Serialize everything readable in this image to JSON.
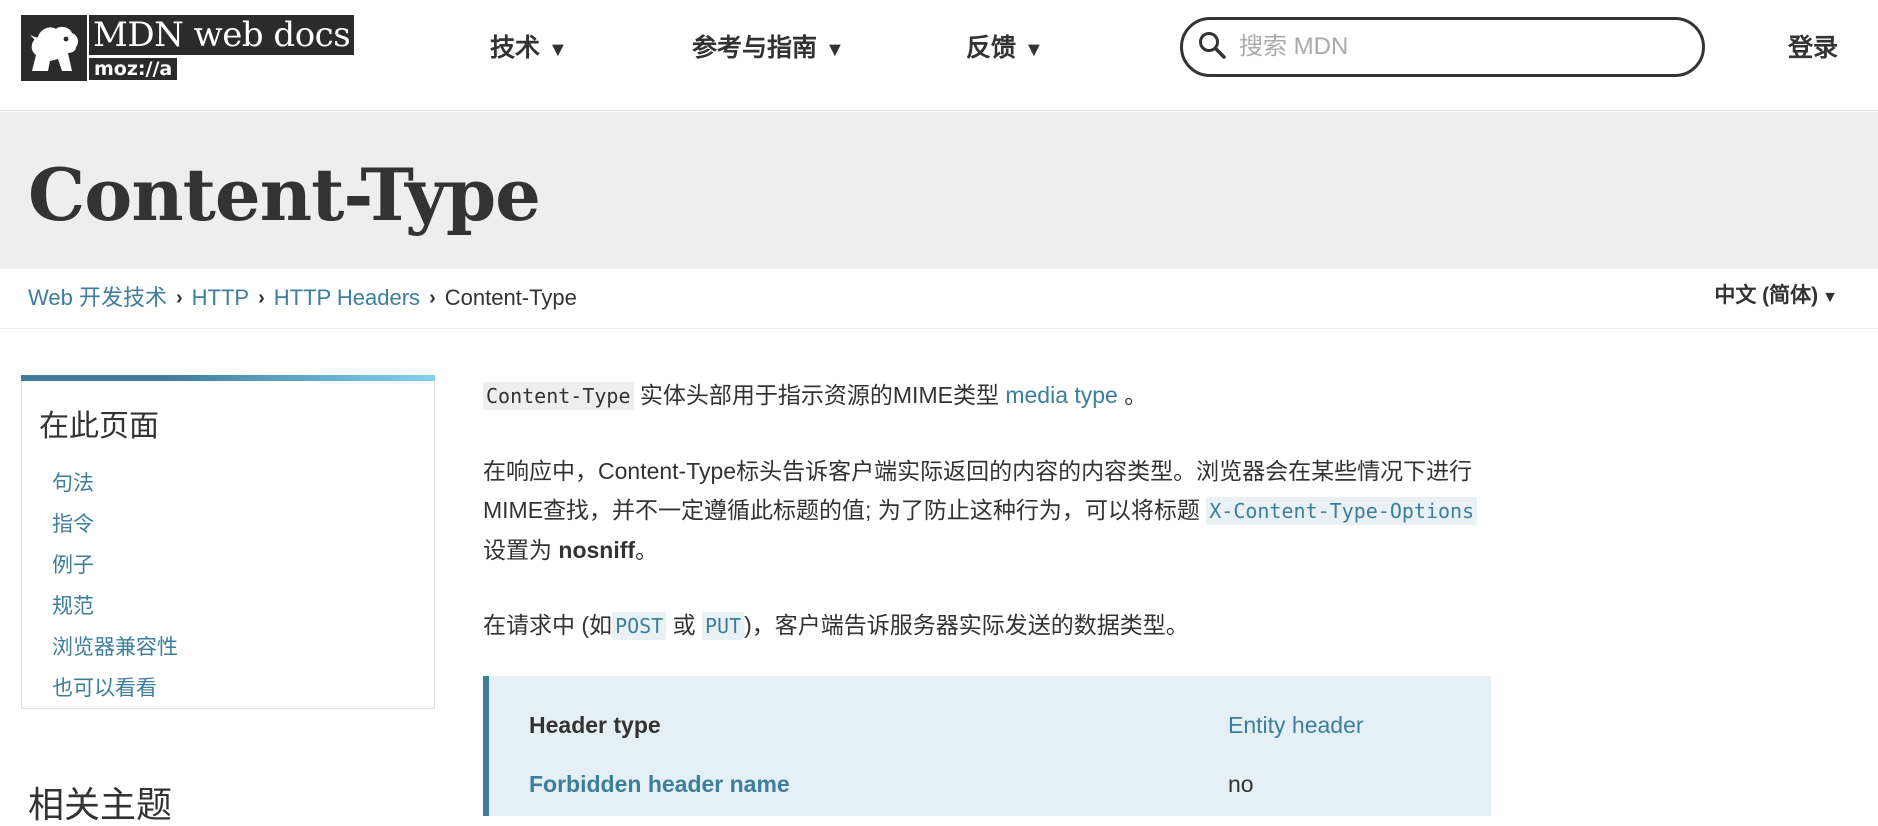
{
  "header": {
    "logo_title": "MDN web docs",
    "logo_sub": "moz://a",
    "nav": [
      {
        "label": "技术",
        "caret": "▼"
      },
      {
        "label": "参考与指南",
        "caret": "▼"
      },
      {
        "label": "反馈",
        "caret": "▼"
      }
    ],
    "search_placeholder": "搜索 MDN",
    "login_label": "登录"
  },
  "page": {
    "title": "Content-Type"
  },
  "breadcrumb": {
    "items": [
      "Web 开发技术",
      "HTTP",
      "HTTP Headers"
    ],
    "separator": "›",
    "current": "Content-Type"
  },
  "language": {
    "label": "中文 (简体)",
    "caret": "▼"
  },
  "toc": {
    "title": "在此页面",
    "items": [
      "句法",
      "指令",
      "例子",
      "规范",
      "浏览器兼容性",
      "也可以看看"
    ]
  },
  "related": {
    "title": "相关主题"
  },
  "content": {
    "p1": {
      "code": "Content-Type",
      "text": " 实体头部用于指示资源的MIME类型 ",
      "link": "media type",
      "end": " 。"
    },
    "p2": {
      "text1": "在响应中，Content-Type标头告诉客户端实际返回的内容的内容类型。浏览器会在某些情况下进行MIME查找，并不一定遵循此标题的值; 为了防止这种行为，可以将标题 ",
      "code_link": "X-Content-Type-Options",
      "text2": " 设置为 ",
      "bold": "nosniff",
      "end": "。"
    },
    "p3": {
      "text1": "在请求中 (如",
      "code1": "POST",
      "text2": " 或 ",
      "code2": "PUT",
      "text3": ")，客户端告诉服务器实际发送的数据类型。"
    }
  },
  "infobox": {
    "rows": [
      {
        "key": "Header type",
        "value": "Entity header"
      },
      {
        "key": "Forbidden header name",
        "value": "no"
      }
    ]
  }
}
